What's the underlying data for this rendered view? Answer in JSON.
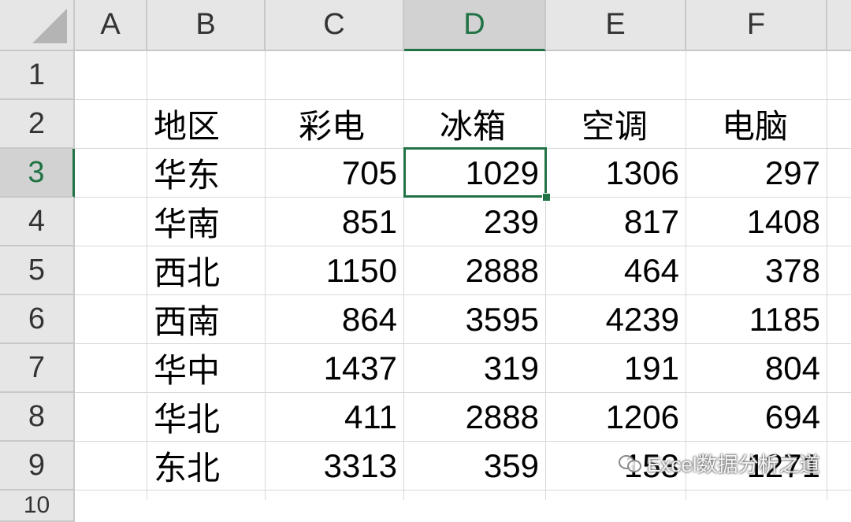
{
  "columns": [
    "A",
    "B",
    "C",
    "D",
    "E",
    "F"
  ],
  "rows": [
    "1",
    "2",
    "3",
    "4",
    "5",
    "6",
    "7",
    "8",
    "9",
    "10"
  ],
  "active_cell": "D3",
  "headers": {
    "B": "地区",
    "C": "彩电",
    "D": "冰箱",
    "E": "空调",
    "F": "电脑"
  },
  "data": [
    {
      "region": "华东",
      "tv": "705",
      "fridge": "1029",
      "ac": "1306",
      "pc": "297"
    },
    {
      "region": "华南",
      "tv": "851",
      "fridge": "239",
      "ac": "817",
      "pc": "1408"
    },
    {
      "region": "西北",
      "tv": "1150",
      "fridge": "2888",
      "ac": "464",
      "pc": "378"
    },
    {
      "region": "西南",
      "tv": "864",
      "fridge": "3595",
      "ac": "4239",
      "pc": "1185"
    },
    {
      "region": "华中",
      "tv": "1437",
      "fridge": "319",
      "ac": "191",
      "pc": "804"
    },
    {
      "region": "华北",
      "tv": "411",
      "fridge": "2888",
      "ac": "1206",
      "pc": "694"
    },
    {
      "region": "东北",
      "tv": "3313",
      "fridge": "359",
      "ac": "153",
      "pc": "1271"
    }
  ],
  "watermark": "Excel数据分析之道",
  "colors": {
    "accent": "#217346",
    "header_bg": "#e6e6e6",
    "grid": "#d8d8d8"
  }
}
